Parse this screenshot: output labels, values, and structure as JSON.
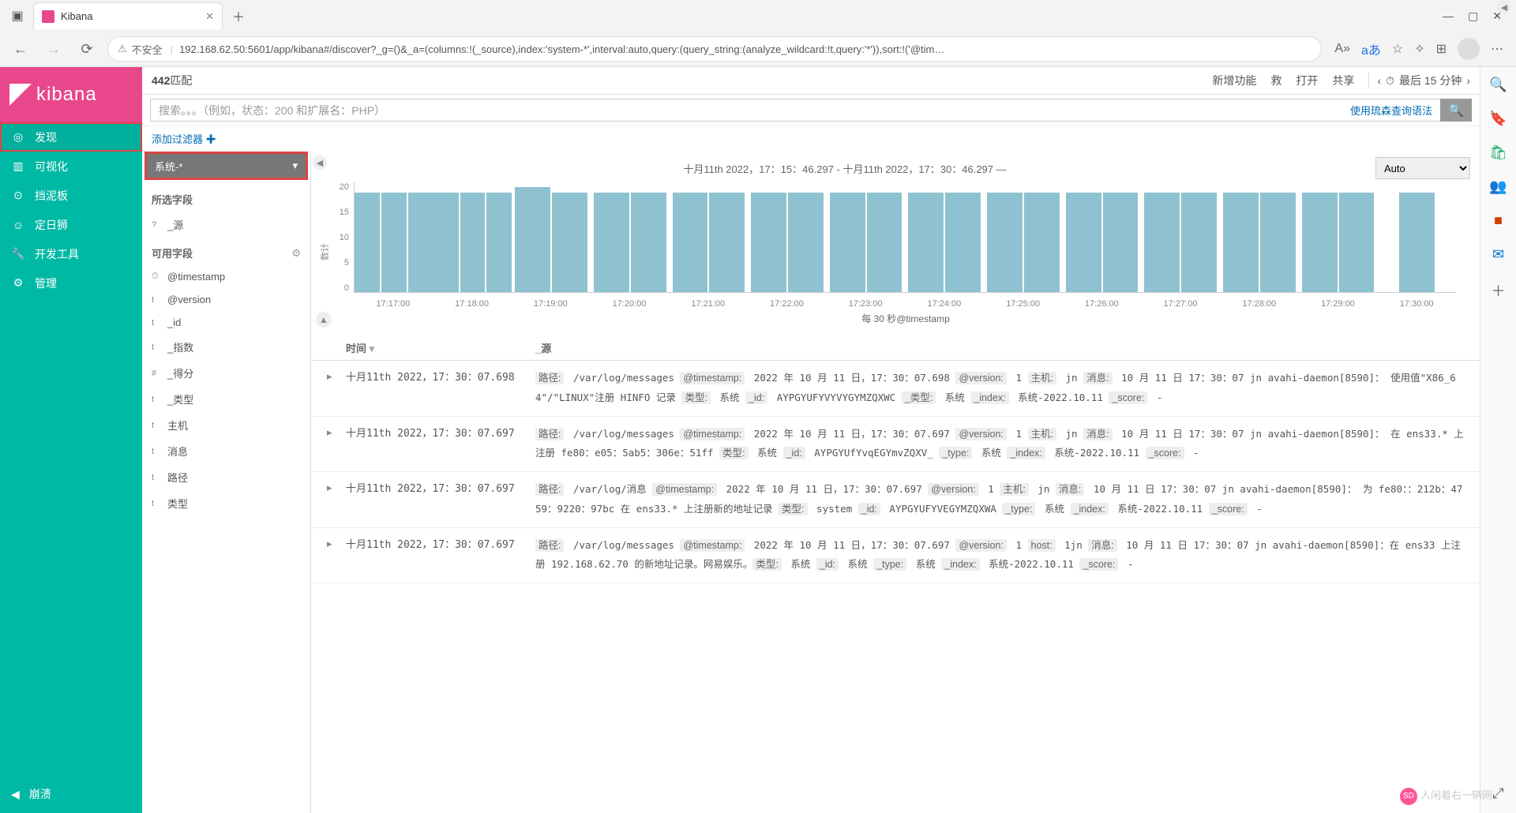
{
  "browser": {
    "tab_title": "Kibana",
    "address_insecure": "不安全",
    "address": "192.168.62.50:5601/app/kibana#/discover?_g=()&_a=(columns:!(_source),index:'system-*',interval:auto,query:(query_string:(analyze_wildcard:!t,query:'*')),sort:!('@tim…",
    "aa_badge": "A»",
    "lang_badge": "aあ"
  },
  "sidebar": {
    "logo": "kibana",
    "items": [
      {
        "icon": "◎",
        "label": "发现"
      },
      {
        "icon": "▥",
        "label": "可视化"
      },
      {
        "icon": "⊙",
        "label": "挡泥板"
      },
      {
        "icon": "☺",
        "label": "定日狮"
      },
      {
        "icon": "🔧",
        "label": "开发工具"
      },
      {
        "icon": "⚙",
        "label": "管理"
      }
    ],
    "footer": {
      "icon": "◀",
      "label": "崩溃"
    }
  },
  "topbar": {
    "hits_count": "442",
    "hits_label": "匹配",
    "actions": [
      "新增功能",
      "救",
      "打开",
      "共享"
    ],
    "prev": "‹",
    "clock": "⏱",
    "time_label": "最后 15 分钟",
    "next": "›"
  },
  "search": {
    "placeholder": "搜索。。。（例如，状态：200 和扩展名：PHP）",
    "syntax_link": "使用琉森查询语法",
    "filter_link": "添加过滤器",
    "filter_plus": "✚"
  },
  "index_pattern": "系统-*",
  "fields": {
    "selected_header": "所选字段",
    "selected": [
      {
        "type": "?",
        "name": "_源"
      }
    ],
    "available_header": "可用字段",
    "available": [
      {
        "type": "⏱",
        "name": "@timestamp"
      },
      {
        "type": "t",
        "name": "@version"
      },
      {
        "type": "t",
        "name": "_id"
      },
      {
        "type": "t",
        "name": "_指数"
      },
      {
        "type": "#",
        "name": "_得分"
      },
      {
        "type": "t",
        "name": "_类型"
      },
      {
        "type": "t",
        "name": "主机"
      },
      {
        "type": "t",
        "name": "消息"
      },
      {
        "type": "t",
        "name": "路径"
      },
      {
        "type": "t",
        "name": "类型"
      }
    ],
    "gear": "⚙"
  },
  "histogram": {
    "range_label": "十月11th 2022，17：15：46.297 - 十月11th 2022，17：30：46.297 —",
    "interval_select": "Auto",
    "y_label": "数计",
    "footer": "每 30 秒@timestamp"
  },
  "chart_data": {
    "type": "bar",
    "ylim": [
      0,
      22
    ],
    "yticks": [
      0,
      5,
      10,
      15,
      20
    ],
    "xlabel": "",
    "ylabel": "数计",
    "x_ticks": [
      "17:17:00",
      "17:18:00",
      "17:19:00",
      "17:20:00",
      "17:21:00",
      "17:22:00",
      "17:23:00",
      "17:24:00",
      "17:25:00",
      "17:26:00",
      "17:27:00",
      "17:28:00",
      "17:29:00",
      "17:30:00"
    ],
    "groups": [
      [
        20,
        20,
        20
      ],
      [
        20,
        20,
        20
      ],
      [
        21,
        20
      ],
      [
        20,
        20
      ],
      [
        20,
        20
      ],
      [
        20,
        20
      ],
      [
        20,
        20
      ],
      [
        20,
        20
      ],
      [
        20,
        20
      ],
      [
        20,
        20
      ],
      [
        20,
        20
      ],
      [
        20,
        20
      ],
      [
        20,
        20
      ],
      [
        20
      ]
    ]
  },
  "table": {
    "col_time": "时间",
    "col_source": "_源",
    "rows": [
      {
        "time": "十月11th 2022，17：30：07.698",
        "source": "<span class='fld'>路径:</span> /var/log/messages <span class='fld'>@timestamp:</span> 2022 年 10 月 11 日，17：30：07.698 <span class='fld'>@version:</span> 1 <span class='fld'>主机:</span> jn <span class='fld'>消息:</span> 10 月 11 日 17：30：07 jn avahi-daemon[8590]： 使用值\"X86_64\"/\"LINUX\"注册 HINFO 记录 <span class='fld'>类型:</span> 系统 <span class='fld'>_id:</span> AYPGYUFYVYVYGYMZQXWC <span class='fld'>_类型:</span> 系统 <span class='fld'>_index:</span> 系统-2022.10.11 <span class='fld'>_score:</span> -"
      },
      {
        "time": "十月11th 2022，17：30：07.697",
        "source": "<span class='fld'>路径:</span> /var/log/messages <span class='fld'>@timestamp:</span> 2022 年 10 月 11 日，17：30：07.697 <span class='fld'>@version:</span> 1 <span class='fld'>主机:</span> jn <span class='fld'>消息:</span> 10 月 11 日 17：30：07 jn avahi-daemon[8590]： 在 ens33.* 上注册 fe80：e05：5ab5：306e：51ff <span class='fld'>类型:</span> 系统 <span class='fld'>_id:</span> AYPGYUfYvqEGYmvZQXV_ <span class='fld'>_type:</span> 系统 <span class='fld'>_index:</span> 系统-2022.10.11 <span class='fld'>_score:</span> -"
      },
      {
        "time": "十月11th 2022，17：30：07.697",
        "source": "<span class='fld'>路径:</span> /var/log/消息 <span class='fld'>@timestamp:</span> 2022 年 10 月 11 日，17：30：07.697 <span class='fld'>@version:</span> 1 <span class='fld'>主机:</span> jn <span class='fld'>消息:</span> 10 月 11 日 17：30：07 jn avahi-daemon[8590]： 为 fe80：：212b：4759：9220：97bc 在 ens33.* 上注册新的地址记录 <span class='fld'>类型:</span> system <span class='fld'>_id:</span> AYPGYUFYVEGYMZQXWA <span class='fld'>_type:</span> 系统 <span class='fld'>_index:</span> 系统-2022.10.11 <span class='fld'>_score:</span> -"
      },
      {
        "time": "十月11th 2022，17：30：07.697",
        "source": "<span class='fld'>路径:</span> /var/log/messages <span class='fld'>@timestamp:</span> 2022 年 10 月 11 日，17：30：07.697 <span class='fld'>@version:</span> 1 <span class='fld'>host:</span> 1jn <span class='fld'>消息:</span> 10 月 11 日 17：30：07 jn avahi-daemon[8590]：在 ens33 上注册 192.168.62.70 的新地址记录。网易娱乐。<span class='fld'>类型:</span> 系统 <span class='fld'>_id:</span> 系统 <span class='fld'>_type:</span> 系统 <span class='fld'>_index:</span> 系统-2022.10.11 <span class='fld'>_score:</span> -"
      }
    ]
  },
  "watermark": "人闲着右一辆网"
}
